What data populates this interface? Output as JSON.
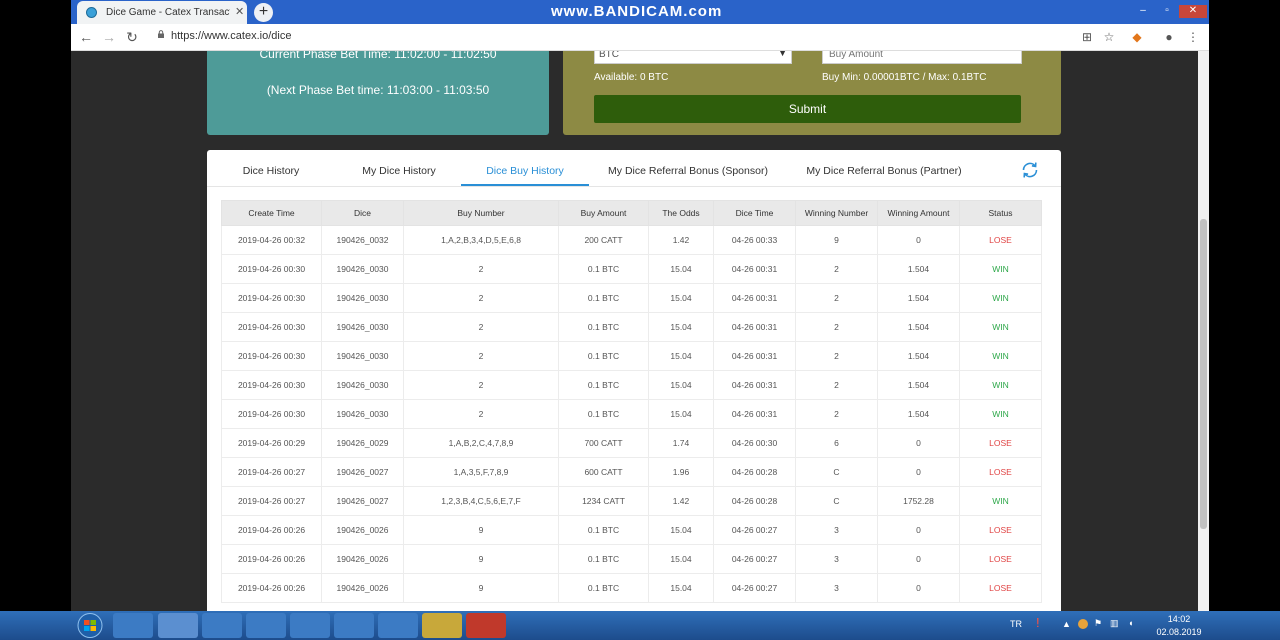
{
  "browser": {
    "tab_title": "Dice Game - Catex Transaction M",
    "url": "https://www.catex.io/dice",
    "watermark": "www.BANDICAM.com"
  },
  "phase": {
    "current": "Current Phase Bet Time: 11:02:00 - 11:02:50",
    "next": "(Next Phase Bet time: 11:03:00 - 11:03:50"
  },
  "buy": {
    "coin": "BTC",
    "amount_placeholder": "Buy Amount",
    "available": "Available: 0 BTC",
    "limits": "Buy Min: 0.00001BTC  /  Max: 0.1BTC",
    "submit_label": "Submit"
  },
  "history": {
    "tabs": [
      {
        "label": "Dice History"
      },
      {
        "label": "My Dice History"
      },
      {
        "label": "Dice Buy History"
      },
      {
        "label": "My Dice Referral Bonus (Sponsor)"
      },
      {
        "label": "My Dice Referral Bonus (Partner)"
      }
    ],
    "active_tab": 2,
    "columns": [
      "Create Time",
      "Dice",
      "Buy Number",
      "Buy Amount",
      "The Odds",
      "Dice Time",
      "Winning Number",
      "Winning Amount",
      "Status"
    ],
    "rows": [
      [
        "2019-04-26 00:32",
        "190426_0032",
        "1,A,2,B,3,4,D,5,E,6,8",
        "200 CATT",
        "1.42",
        "04-26 00:33",
        "9",
        "0",
        "LOSE"
      ],
      [
        "2019-04-26 00:30",
        "190426_0030",
        "2",
        "0.1 BTC",
        "15.04",
        "04-26 00:31",
        "2",
        "1.504",
        "WIN"
      ],
      [
        "2019-04-26 00:30",
        "190426_0030",
        "2",
        "0.1 BTC",
        "15.04",
        "04-26 00:31",
        "2",
        "1.504",
        "WIN"
      ],
      [
        "2019-04-26 00:30",
        "190426_0030",
        "2",
        "0.1 BTC",
        "15.04",
        "04-26 00:31",
        "2",
        "1.504",
        "WIN"
      ],
      [
        "2019-04-26 00:30",
        "190426_0030",
        "2",
        "0.1 BTC",
        "15.04",
        "04-26 00:31",
        "2",
        "1.504",
        "WIN"
      ],
      [
        "2019-04-26 00:30",
        "190426_0030",
        "2",
        "0.1 BTC",
        "15.04",
        "04-26 00:31",
        "2",
        "1.504",
        "WIN"
      ],
      [
        "2019-04-26 00:30",
        "190426_0030",
        "2",
        "0.1 BTC",
        "15.04",
        "04-26 00:31",
        "2",
        "1.504",
        "WIN"
      ],
      [
        "2019-04-26 00:29",
        "190426_0029",
        "1,A,B,2,C,4,7,8,9",
        "700 CATT",
        "1.74",
        "04-26 00:30",
        "6",
        "0",
        "LOSE"
      ],
      [
        "2019-04-26 00:27",
        "190426_0027",
        "1,A,3,5,F,7,8,9",
        "600 CATT",
        "1.96",
        "04-26 00:28",
        "C",
        "0",
        "LOSE"
      ],
      [
        "2019-04-26 00:27",
        "190426_0027",
        "1,2,3,B,4,C,5,6,E,7,F",
        "1234 CATT",
        "1.42",
        "04-26 00:28",
        "C",
        "1752.28",
        "WIN"
      ],
      [
        "2019-04-26 00:26",
        "190426_0026",
        "9",
        "0.1 BTC",
        "15.04",
        "04-26 00:27",
        "3",
        "0",
        "LOSE"
      ],
      [
        "2019-04-26 00:26",
        "190426_0026",
        "9",
        "0.1 BTC",
        "15.04",
        "04-26 00:27",
        "3",
        "0",
        "LOSE"
      ],
      [
        "2019-04-26 00:26",
        "190426_0026",
        "9",
        "0.1 BTC",
        "15.04",
        "04-26 00:27",
        "3",
        "0",
        "LOSE"
      ]
    ]
  },
  "colors": {
    "win": "#2ea84a",
    "lose": "#e04444",
    "active_tab": "#2a8fd6",
    "submit": "#2e5d0b"
  },
  "taskbar": {
    "language": "TR",
    "time": "14:02",
    "date": "02.08.2019"
  }
}
